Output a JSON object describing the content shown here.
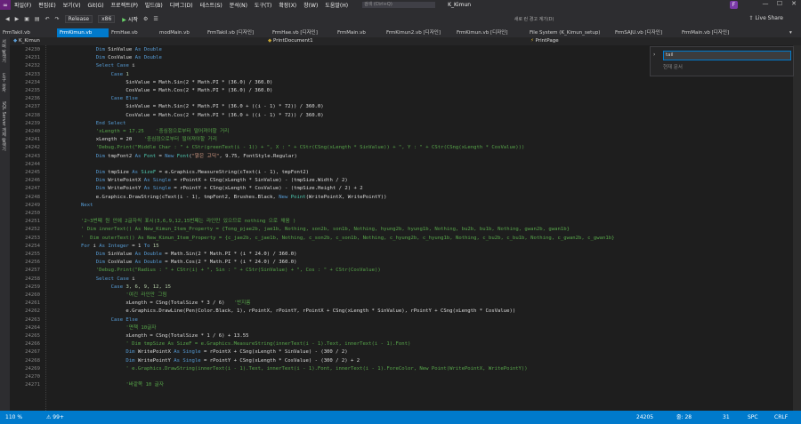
{
  "app": {
    "title": "K_Kimun",
    "logo": "∞",
    "profile_initial": "F"
  },
  "menu": [
    "파일(F)",
    "편집(E)",
    "보기(V)",
    "Git(G)",
    "프로젝트(P)",
    "빌드(B)",
    "디버그(D)",
    "테스트(S)",
    "분석(N)",
    "도구(T)",
    "확장(X)",
    "창(W)",
    "도움말(H)"
  ],
  "search": {
    "placeholder": "검색 (Ctrl+Q)"
  },
  "toolbar": {
    "config": "Release",
    "platform": "x86",
    "start": "시작",
    "live_share": "Live Share",
    "right_hint": "새로 런 경고 계기(D)"
  },
  "doc_tabs": [
    "FrmTakil.vb",
    "FrmKimun.vb",
    "FrmHae.vb",
    "modMain.vb",
    "FrmTakil.vb [디자인]",
    "FrmHae.vb [디자인]",
    "FrmMain.vb",
    "FrmKimun2.vb [디자인]",
    "FrmKimun.vb [디자인]",
    "File System (K_Kimun_setup)",
    "FrmSAJU.vb [디자인]",
    "FrmMain.vb [디자인]"
  ],
  "side_labels": [
    "서버 탐색기",
    "도구 상자",
    "SQL Server 개체 탐색기"
  ],
  "nav": {
    "project": "K_Kimun",
    "object": "PrintDocument1",
    "method": "PrintPage"
  },
  "find": {
    "value": "tail",
    "hint": "현재 문서"
  },
  "code_lines": [
    {
      "n": "24230",
      "segs": [
        {
          "c": "kw",
          "t": "Dim "
        },
        {
          "c": "id",
          "t": "SinValue "
        },
        {
          "c": "kw",
          "t": "As "
        },
        {
          "c": "kw",
          "t": "Double"
        }
      ],
      "i": 14
    },
    {
      "n": "24231",
      "segs": [
        {
          "c": "kw",
          "t": "Dim "
        },
        {
          "c": "id",
          "t": "CosValue "
        },
        {
          "c": "kw",
          "t": "As "
        },
        {
          "c": "kw",
          "t": "Double"
        }
      ],
      "i": 14
    },
    {
      "n": "24232",
      "segs": [
        {
          "c": "kw",
          "t": "Select Case "
        },
        {
          "c": "id",
          "t": "i"
        }
      ],
      "i": 14
    },
    {
      "n": "24233",
      "segs": [
        {
          "c": "kw",
          "t": "Case "
        },
        {
          "c": "nm",
          "t": "1"
        }
      ],
      "i": 18
    },
    {
      "n": "24234",
      "segs": [
        {
          "c": "id",
          "t": "SinValue = Math.Sin(2 * Math.PI * (36.0) / 360.0)"
        }
      ],
      "i": 22
    },
    {
      "n": "24235",
      "segs": [
        {
          "c": "id",
          "t": "CosValue = Math.Cos(2 * Math.PI * (36.0) / 360.0)"
        }
      ],
      "i": 22
    },
    {
      "n": "24236",
      "segs": [
        {
          "c": "kw",
          "t": "Case Else"
        }
      ],
      "i": 18
    },
    {
      "n": "24237",
      "segs": [
        {
          "c": "id",
          "t": "SinValue = Math.Sin(2 * Math.PI * (36.0 + ((i - 1) * 72)) / 360.0)"
        }
      ],
      "i": 22
    },
    {
      "n": "24238",
      "segs": [
        {
          "c": "id",
          "t": "CosValue = Math.Cos(2 * Math.PI * (36.0 + ((i - 1) * 72)) / 360.0)"
        }
      ],
      "i": 22
    },
    {
      "n": "24239",
      "segs": [
        {
          "c": "kw",
          "t": "End Select"
        }
      ],
      "i": 14
    },
    {
      "n": "24240",
      "segs": [
        {
          "c": "cm",
          "t": "'xLength = 17.25    '중심점으로부터 떨어져야할 거리"
        }
      ],
      "i": 14
    },
    {
      "n": "24241",
      "segs": [
        {
          "c": "id",
          "t": "xLength = 20    "
        },
        {
          "c": "cm",
          "t": "'중심점으로부터 떨어져야할 거리"
        }
      ],
      "i": 14
    },
    {
      "n": "24242",
      "segs": [
        {
          "c": "cm",
          "t": "'Debug.Print(\"Middle Char : \" + CStr(greenText(i - 1)) + \", X : \" + CStr(CSng(xLength * SinValue)) + \", Y : \" + CStr(CSng(xLength * CosValue)))"
        }
      ],
      "i": 14
    },
    {
      "n": "24243",
      "segs": [
        {
          "c": "kw",
          "t": "Dim "
        },
        {
          "c": "id",
          "t": "tmpFont2 "
        },
        {
          "c": "kw",
          "t": "As "
        },
        {
          "c": "tp",
          "t": "Font "
        },
        {
          "c": "id",
          "t": "= "
        },
        {
          "c": "kw",
          "t": "New "
        },
        {
          "c": "tp",
          "t": "Font"
        },
        {
          "c": "id",
          "t": "("
        },
        {
          "c": "st",
          "t": "\"맑은 고딕\""
        },
        {
          "c": "id",
          "t": ", 9.75, FontStyle.Regular)"
        }
      ],
      "i": 14
    },
    {
      "n": "24244",
      "segs": [],
      "i": 14
    },
    {
      "n": "24245",
      "segs": [
        {
          "c": "kw",
          "t": "Dim "
        },
        {
          "c": "id",
          "t": "tmpSize "
        },
        {
          "c": "kw",
          "t": "As "
        },
        {
          "c": "tp",
          "t": "SizeF "
        },
        {
          "c": "id",
          "t": "= e.Graphics.MeasureString(cText(i - 1), tmpFont2)"
        }
      ],
      "i": 14
    },
    {
      "n": "24246",
      "segs": [
        {
          "c": "kw",
          "t": "Dim "
        },
        {
          "c": "id",
          "t": "WritePointX "
        },
        {
          "c": "kw",
          "t": "As "
        },
        {
          "c": "kw",
          "t": "Single "
        },
        {
          "c": "id",
          "t": "= rPointX + CSng(xLength * SinValue) - (tmpSize.Width / 2)"
        }
      ],
      "i": 14
    },
    {
      "n": "24247",
      "segs": [
        {
          "c": "kw",
          "t": "Dim "
        },
        {
          "c": "id",
          "t": "WritePointY "
        },
        {
          "c": "kw",
          "t": "As "
        },
        {
          "c": "kw",
          "t": "Single "
        },
        {
          "c": "id",
          "t": "= rPointY + CSng(xLength * CosValue) - (tmpSize.Height / 2) + 2"
        }
      ],
      "i": 14
    },
    {
      "n": "24248",
      "segs": [
        {
          "c": "id",
          "t": "e.Graphics.DrawString(cText(i - 1), tmpFont2, Brushes.Black, "
        },
        {
          "c": "kw",
          "t": "New "
        },
        {
          "c": "tp",
          "t": "Point"
        },
        {
          "c": "id",
          "t": "(WritePointX, WritePointY))"
        }
      ],
      "i": 14
    },
    {
      "n": "24249",
      "segs": [
        {
          "c": "kw",
          "t": "Next"
        }
      ],
      "i": 10
    },
    {
      "n": "24250",
      "segs": [],
      "i": 10
    },
    {
      "n": "24251",
      "segs": [
        {
          "c": "cm",
          "t": "'2~3번째 원 안에 2글자씩 표시(3,6,9,12,15번째는 라인만 있으므로 nothing 으로 채움 )"
        }
      ],
      "i": 10
    },
    {
      "n": "24252",
      "segs": [
        {
          "c": "cm",
          "t": "' Dim innerText() As New_Kimun_Item_Property = {Tong_pjae2b, jae1b, Nothing, son2b, son1b, Nothing, hyung2b, hyung1b, Nothing, bu2b, bu1b, Nothing, gwan2b, gwan1b}"
        }
      ],
      "i": 10
    },
    {
      "n": "24253",
      "segs": [
        {
          "c": "cm",
          "t": "'  Dim outerText() As New_Kimun_Item_Property = {c_jae2b, c_jae1b, Nothing, c_son2b, c_son1b, Nothing, c_hyung2b, c_hyung1b, Nothing, c_bu2b, c_bu1b, Nothing, c_gwan2b, c_gwan1b}"
        }
      ],
      "i": 10
    },
    {
      "n": "24254",
      "segs": [
        {
          "c": "kw",
          "t": "For "
        },
        {
          "c": "id",
          "t": "i "
        },
        {
          "c": "kw",
          "t": "As Integer "
        },
        {
          "c": "id",
          "t": "= 1 "
        },
        {
          "c": "kw",
          "t": "To "
        },
        {
          "c": "nm",
          "t": "15"
        }
      ],
      "i": 10
    },
    {
      "n": "24255",
      "segs": [
        {
          "c": "kw",
          "t": "Dim "
        },
        {
          "c": "id",
          "t": "SinValue "
        },
        {
          "c": "kw",
          "t": "As Double "
        },
        {
          "c": "id",
          "t": "= Math.Sin(2 * Math.PI * (i * 24.0) / 360.0)"
        }
      ],
      "i": 14
    },
    {
      "n": "24256",
      "segs": [
        {
          "c": "kw",
          "t": "Dim "
        },
        {
          "c": "id",
          "t": "CosValue "
        },
        {
          "c": "kw",
          "t": "As Double "
        },
        {
          "c": "id",
          "t": "= Math.Cos(2 * Math.PI * (i * 24.0) / 360.0)"
        }
      ],
      "i": 14
    },
    {
      "n": "24257",
      "segs": [
        {
          "c": "cm",
          "t": "'Debug.Print(\"Radius : \" + CStr(i) + \", Sin : \" + CStr(SinValue) + \", Cos : \" + CStr(CosValue))"
        }
      ],
      "i": 14
    },
    {
      "n": "24258",
      "segs": [
        {
          "c": "kw",
          "t": "Select Case "
        },
        {
          "c": "id",
          "t": "i"
        }
      ],
      "i": 14
    },
    {
      "n": "24259",
      "segs": [
        {
          "c": "kw",
          "t": "Case "
        },
        {
          "c": "nm",
          "t": "3, 6, 9, 12, 15"
        }
      ],
      "i": 18
    },
    {
      "n": "24260",
      "segs": [
        {
          "c": "cm",
          "t": "'여긴 라인만 그림"
        }
      ],
      "i": 22
    },
    {
      "n": "24261",
      "segs": [
        {
          "c": "id",
          "t": "xLength = CSng(TotalSize * 3 / 6)   "
        },
        {
          "c": "cm",
          "t": "'반지름"
        }
      ],
      "i": 22
    },
    {
      "n": "24262",
      "segs": [
        {
          "c": "id",
          "t": "e.Graphics.DrawLine(Pen(Color.Black, 1), rPointX, rPointY, rPointX + CSng(xLength * SinValue), rPointY + CSng(xLength * CosValue))"
        }
      ],
      "i": 22
    },
    {
      "n": "24263",
      "segs": [
        {
          "c": "kw",
          "t": "Case Else"
        }
      ],
      "i": 18
    },
    {
      "n": "24264",
      "segs": [
        {
          "c": "cm",
          "t": "'면책 10글자"
        }
      ],
      "i": 22
    },
    {
      "n": "24265",
      "segs": [
        {
          "c": "id",
          "t": "xLength = CSng(TotalSize * 1 / 6) + 13.55"
        }
      ],
      "i": 22
    },
    {
      "n": "24266",
      "segs": [
        {
          "c": "cm",
          "t": "' Dim tmpSize As SizeF = e.Graphics.MeasureString(innerText(i - 1).Text, innerText(i - 1).Font)"
        }
      ],
      "i": 22
    },
    {
      "n": "24267",
      "segs": [
        {
          "c": "kw",
          "t": "Dim "
        },
        {
          "c": "id",
          "t": "WritePointX "
        },
        {
          "c": "kw",
          "t": "As Single "
        },
        {
          "c": "id",
          "t": "= rPointX + CSng(xLength * SinValue) - (300 / 2)"
        }
      ],
      "i": 22
    },
    {
      "n": "24268",
      "segs": [
        {
          "c": "kw",
          "t": "Dim "
        },
        {
          "c": "id",
          "t": "WritePointY "
        },
        {
          "c": "kw",
          "t": "As Single "
        },
        {
          "c": "id",
          "t": "= rPointY + CSng(xLength * CosValue) - (300 / 2) + 2"
        }
      ],
      "i": 22
    },
    {
      "n": "24269",
      "segs": [
        {
          "c": "cm",
          "t": "' e.Graphics.DrawString(innerText(i - 1).Text, innerText(i - 1).Font, innerText(i - 1).ForeColor, New Point(WritePointX, WritePointY))"
        }
      ],
      "i": 22
    },
    {
      "n": "24270",
      "segs": [],
      "i": 22
    },
    {
      "n": "24271",
      "segs": [
        {
          "c": "cm",
          "t": "'바깥쪽 10 글자"
        }
      ],
      "i": 22
    }
  ],
  "status": {
    "zoom": "110 %",
    "issues": "99+",
    "line": "24205",
    "pos": "줄: 28",
    "col": "31",
    "mode": "SPC",
    "eol": "CRLF"
  },
  "colors": {
    "accent": "#007acc",
    "keyword": "#569cd6",
    "type": "#4ec9b0",
    "comment": "#57a64a",
    "string": "#d69d85"
  }
}
